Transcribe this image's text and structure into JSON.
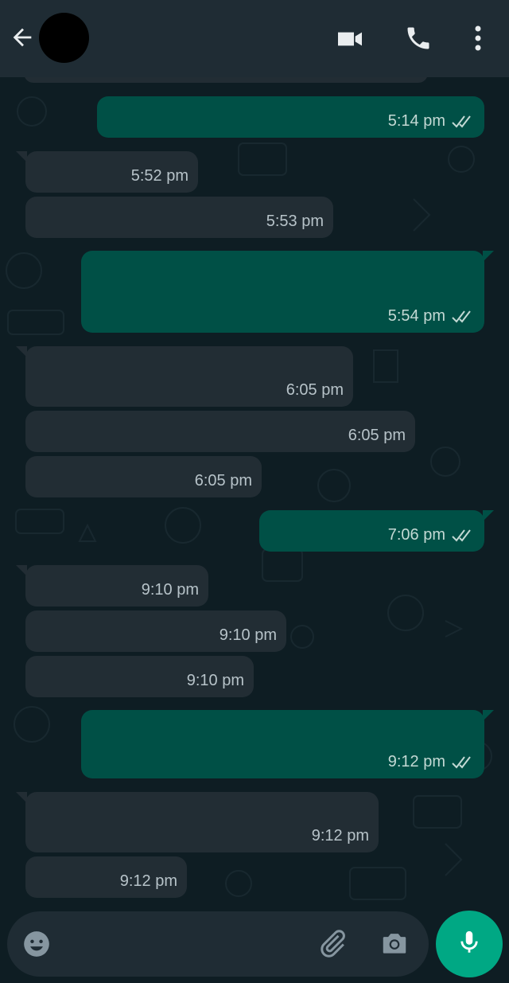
{
  "header": {
    "back_icon": "arrow-left-icon",
    "avatar": "contact-avatar",
    "video_icon": "video-camera-icon",
    "call_icon": "phone-icon",
    "menu_icon": "more-vertical-icon"
  },
  "messages": [
    {
      "dir": "out",
      "time": "5:14 pm",
      "status": "read"
    },
    {
      "dir": "in",
      "time": "5:52 pm"
    },
    {
      "dir": "in",
      "time": "5:53 pm"
    },
    {
      "dir": "out",
      "time": "5:54 pm",
      "status": "read"
    },
    {
      "dir": "in",
      "time": "6:05 pm"
    },
    {
      "dir": "in",
      "time": "6:05 pm"
    },
    {
      "dir": "in",
      "time": "6:05 pm"
    },
    {
      "dir": "out",
      "time": "7:06 pm",
      "status": "read"
    },
    {
      "dir": "in",
      "time": "9:10 pm"
    },
    {
      "dir": "in",
      "time": "9:10 pm"
    },
    {
      "dir": "in",
      "time": "9:10 pm"
    },
    {
      "dir": "out",
      "time": "9:12 pm",
      "status": "read"
    },
    {
      "dir": "in",
      "time": "9:12 pm"
    },
    {
      "dir": "in",
      "time": "9:12 pm"
    }
  ],
  "composer": {
    "placeholder": "",
    "emoji_icon": "emoji-icon",
    "attach_icon": "paperclip-icon",
    "camera_icon": "camera-icon",
    "mic_icon": "microphone-icon"
  },
  "colors": {
    "header_bg": "#1f2c34",
    "incoming_bubble": "#222d34",
    "outgoing_bubble": "#005046",
    "mic_button": "#00a884"
  }
}
